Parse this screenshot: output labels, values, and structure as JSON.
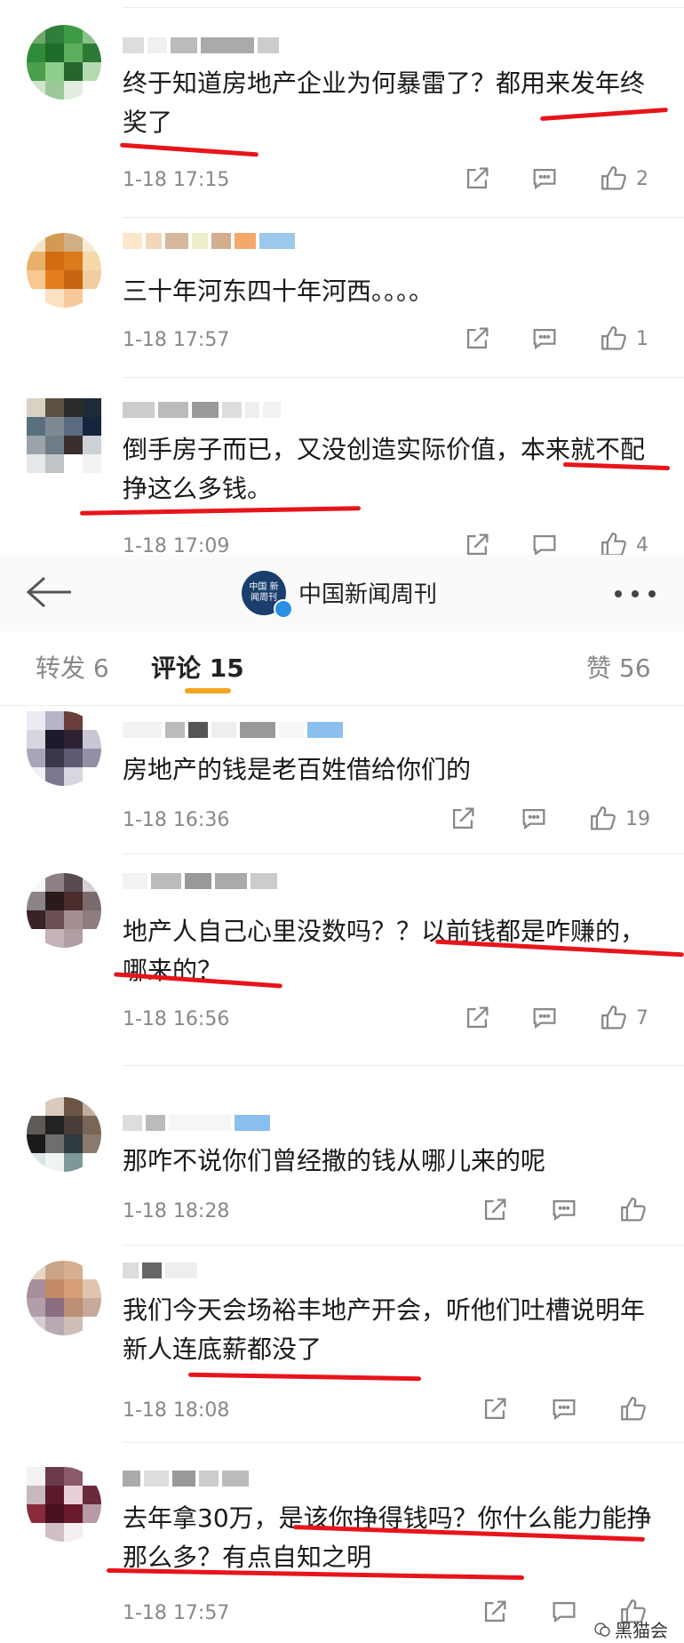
{
  "header": {
    "account_name": "中国新闻周刊",
    "logo_text": "中国 新闻周刊"
  },
  "tabs": [
    {
      "label": "转发 6"
    },
    {
      "label": "评论 15"
    },
    {
      "label": "赞 56"
    }
  ],
  "comments_top": [
    {
      "text": "终于知道房地产企业为何暴雷了？都用来发年终奖了",
      "time": "1-18 17:15",
      "likes": "2"
    },
    {
      "text": "三十年河东四十年河西。。。。",
      "time": "1-18 17:57",
      "likes": "1"
    },
    {
      "text": "倒手房子而已，又没创造实际价值，本来就不配挣这么多钱。",
      "time": "1-18 17:09",
      "likes": "4"
    }
  ],
  "comments": [
    {
      "text": "房地产的钱是老百姓借给你们的",
      "time": "1-18 16:36",
      "likes": "19"
    },
    {
      "text": "地产人自己心里没数吗？？以前钱都是咋赚的，哪来的？",
      "time": "1-18 16:56",
      "likes": "7"
    },
    {
      "text": "那咋不说你们曾经撒的钱从哪儿来的呢",
      "time": "1-18 18:28",
      "likes": ""
    },
    {
      "text": "我们今天会场裕丰地产开会，听他们吐槽说明年新人连底薪都没了",
      "time": "1-18 18:08",
      "likes": ""
    },
    {
      "text": "去年拿30万，是该你挣得钱吗？你什么能力能挣那么多？有点自知之明",
      "time": "1-18 17:57",
      "likes": ""
    }
  ],
  "watermark": "黑猫会",
  "colors": {
    "underline": "#e8141c",
    "tab_indicator": "#f4a623",
    "muted": "#888888"
  }
}
